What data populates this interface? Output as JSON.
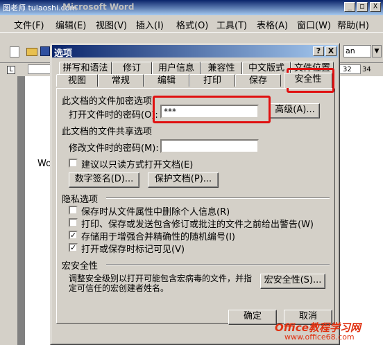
{
  "word": {
    "title": "Microsoft Word",
    "watermark_tl": "图老师 tulaoshi.com",
    "menu": [
      "文件(F)",
      "编辑(E)",
      "视图(V)",
      "插入(I)",
      "格式(O)",
      "工具(T)",
      "表格(A)",
      "窗口(W)",
      "帮助(H)"
    ],
    "doc_text": "Wo",
    "ruler_nums": [
      "32",
      "34"
    ],
    "font_partial": "an"
  },
  "dialog": {
    "title": "选项",
    "help_btn": "?",
    "close_btn": "X",
    "tabs_row1": [
      "拼写和语法",
      "修订",
      "用户信息",
      "兼容性",
      "中文版式",
      "文件位置"
    ],
    "tabs_row2": [
      "视图",
      "常规",
      "编辑",
      "打印",
      "保存",
      "安全性"
    ],
    "encrypt_group": "此文档的文件加密选项",
    "open_pw_label": "打开文件时的密码(O):",
    "open_pw_value": "***",
    "advanced_btn": "高级(A)...",
    "share_group": "此文档的文件共享选项",
    "modify_pw_label": "修改文件时的密码(M):",
    "modify_pw_value": "",
    "readonly_label": "建议以只读方式打开文档(E)",
    "digital_sig_btn": "数字签名(D)...",
    "protect_btn": "保护文档(P)...",
    "privacy_group": "隐私选项",
    "privacy": [
      {
        "label": "保存时从文件属性中删除个人信息(R)",
        "checked": false
      },
      {
        "label": "打印、保存或发送包含修订或批注的文件之前给出警告(W)",
        "checked": false
      },
      {
        "label": "存储用于增强合并精确性的随机编号(I)",
        "checked": true
      },
      {
        "label": "打开或保存时标记可见(V)",
        "checked": true
      }
    ],
    "macro_group": "宏安全性",
    "macro_desc_1": "调整安全级别以打开可能包含宏病毒的文件，并指",
    "macro_desc_2": "定可信任的宏创建者姓名。",
    "macro_btn": "宏安全性(S)...",
    "ok_btn": "确定",
    "cancel_btn": "取消"
  },
  "brand": {
    "name": "Office教程学习网",
    "url": "www.office68.com"
  },
  "colors": {
    "highlight": "#e01010",
    "titlebar": "#0a246a"
  }
}
